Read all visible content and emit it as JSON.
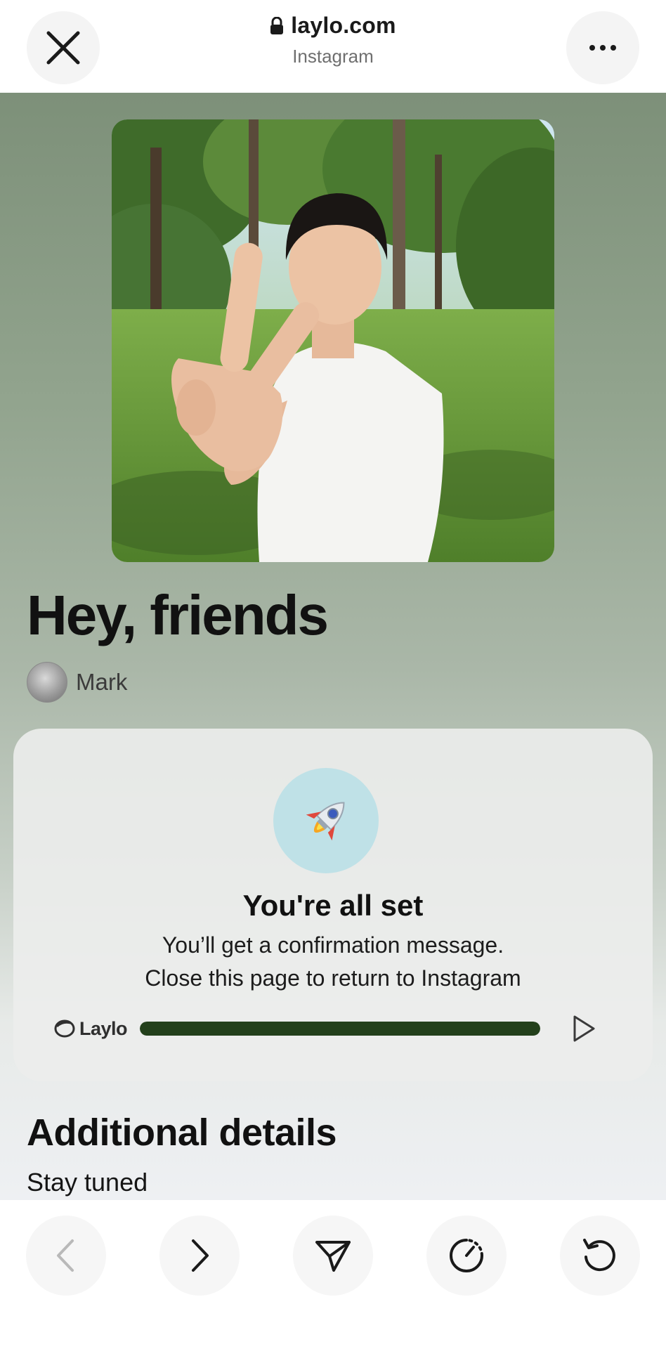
{
  "browser": {
    "domain": "laylo.com",
    "subtitle": "Instagram",
    "icons": {
      "close": "close-icon",
      "more": "more-icon",
      "lock": "lock-icon"
    }
  },
  "post": {
    "title": "Hey, friends",
    "author": "Mark"
  },
  "card": {
    "emoji": "🚀",
    "title": "You're all set",
    "line1": "You’ll get a confirmation message.",
    "line2": "Close this page to return to Instagram",
    "brand": "Laylo",
    "progress": 1.0,
    "accent_color": "#23401b"
  },
  "details": {
    "title": "Additional details",
    "subtitle": "Stay tuned"
  },
  "toolbar": {
    "icons": [
      "back-icon",
      "forward-icon",
      "share-icon",
      "speed-icon",
      "reload-icon"
    ]
  }
}
